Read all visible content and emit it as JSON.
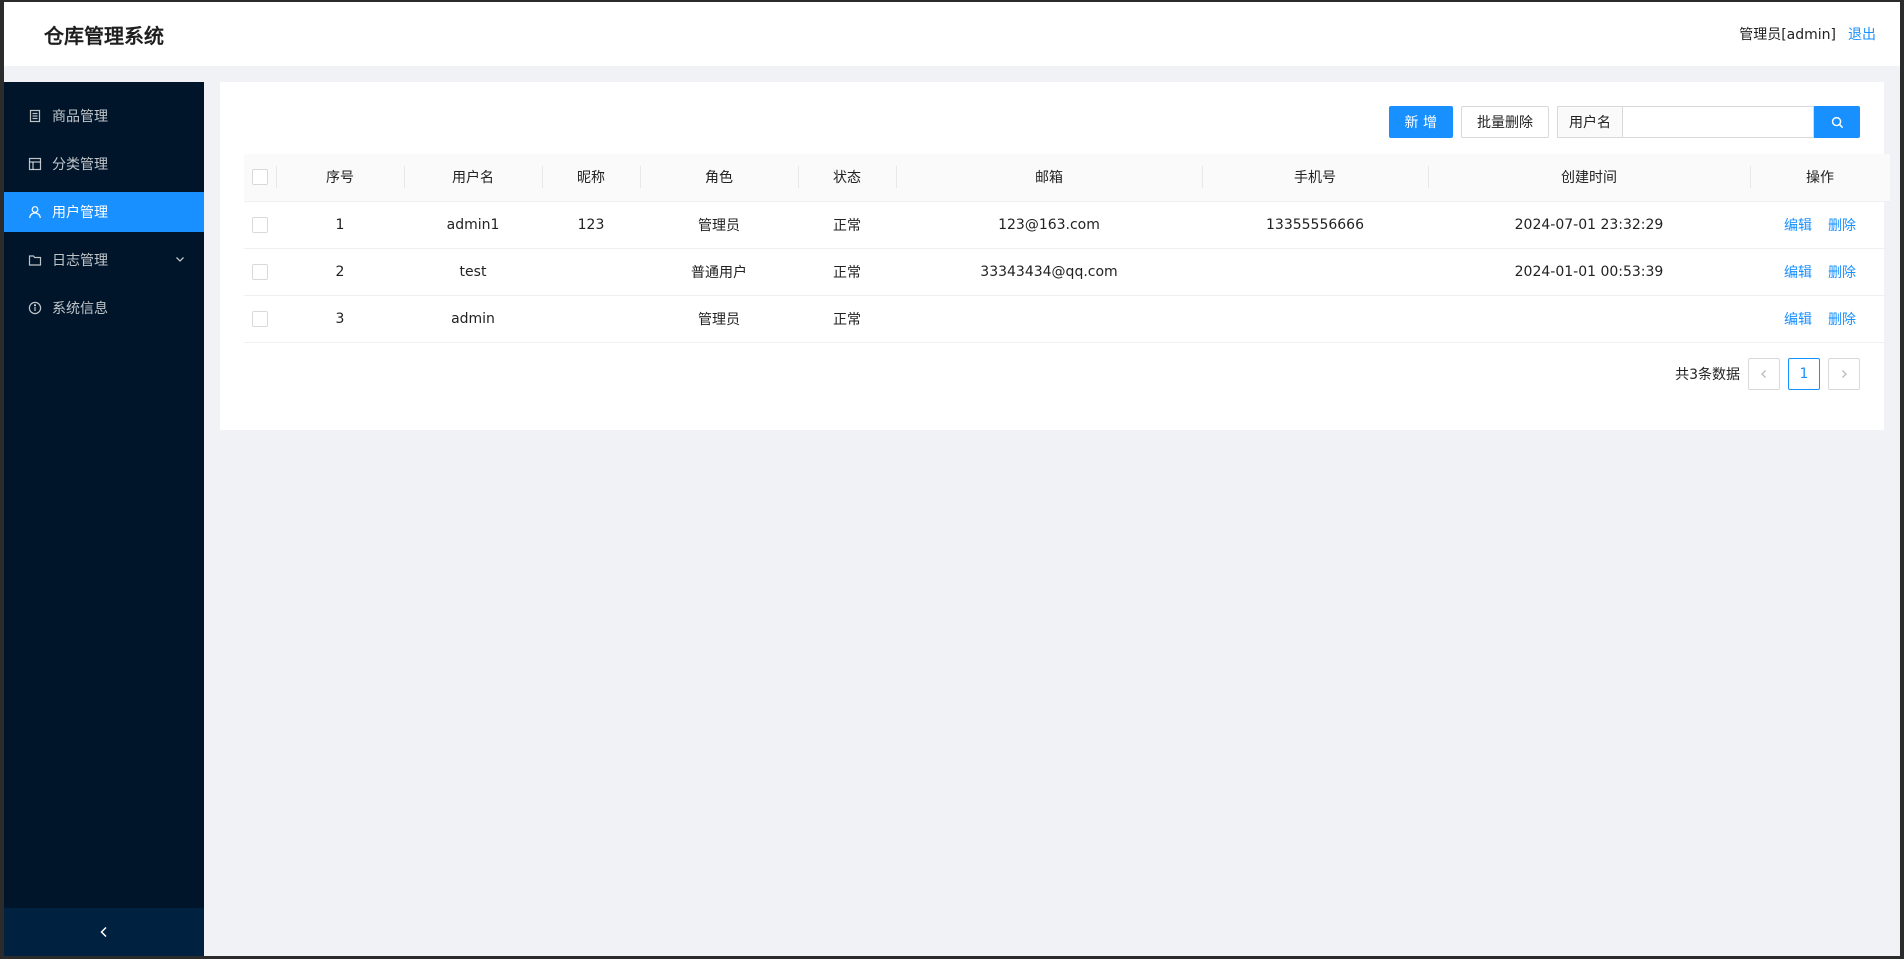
{
  "header": {
    "app_title": "仓库管理系统",
    "user_label": "管理员[admin]",
    "logout_label": "退出"
  },
  "sidebar": {
    "items": [
      {
        "label": "商品管理",
        "icon": "product-list-icon"
      },
      {
        "label": "分类管理",
        "icon": "category-layout-icon"
      },
      {
        "label": "用户管理",
        "icon": "user-icon",
        "active": true
      },
      {
        "label": "日志管理",
        "icon": "folder-icon",
        "has_submenu": true
      },
      {
        "label": "系统信息",
        "icon": "info-circle-icon"
      }
    ],
    "collapse_icon": "chevron-left-icon"
  },
  "toolbar": {
    "add_label": "新 增",
    "batch_delete_label": "批量删除",
    "search_addon": "用户名",
    "search_placeholder": "",
    "search_value": ""
  },
  "table": {
    "columns": [
      "序号",
      "用户名",
      "昵称",
      "角色",
      "状态",
      "邮箱",
      "手机号",
      "创建时间",
      "操作"
    ],
    "rows": [
      {
        "index": "1",
        "username": "admin1",
        "nickname": "123",
        "role": "管理员",
        "status": "正常",
        "email": "123@163.com",
        "phone": "13355556666",
        "created": "2024-07-01 23:32:29"
      },
      {
        "index": "2",
        "username": "test",
        "nickname": "",
        "role": "普通用户",
        "status": "正常",
        "email": "33343434@qq.com",
        "phone": "",
        "created": "2024-01-01 00:53:39"
      },
      {
        "index": "3",
        "username": "admin",
        "nickname": "",
        "role": "管理员",
        "status": "正常",
        "email": "",
        "phone": "",
        "created": ""
      }
    ],
    "edit_label": "编辑",
    "delete_label": "删除"
  },
  "pagination": {
    "total_label": "共3条数据",
    "current_page": "1"
  },
  "colors": {
    "primary": "#1890ff",
    "sidebar_bg": "#001529",
    "sidebar_collapse_bg": "#002140",
    "page_bg": "#f0f2f5"
  }
}
